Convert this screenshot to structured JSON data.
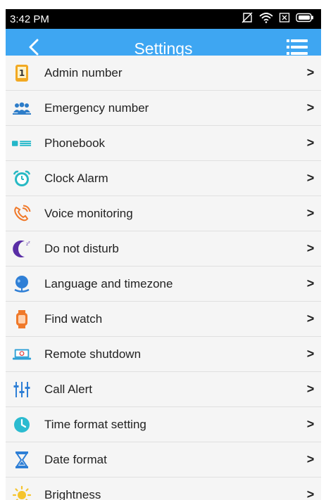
{
  "status_bar": {
    "time": "3:42 PM",
    "icons": [
      "no-sim-icon",
      "wifi-icon",
      "sim-x-icon",
      "battery-icon"
    ]
  },
  "app_bar": {
    "title": "Settings",
    "back_icon": "chevron-left-icon",
    "menu_icon": "menu-list-icon"
  },
  "settings": [
    {
      "label": "Admin number",
      "icon": "admin-number-icon",
      "chevron": ">"
    },
    {
      "label": "Emergency number",
      "icon": "emergency-contacts-icon",
      "chevron": ">"
    },
    {
      "label": "Phonebook",
      "icon": "phonebook-icon",
      "chevron": ">"
    },
    {
      "label": "Clock Alarm",
      "icon": "alarm-clock-icon",
      "chevron": ">"
    },
    {
      "label": "Voice monitoring",
      "icon": "voice-phone-icon",
      "chevron": ">"
    },
    {
      "label": "Do not disturb",
      "icon": "moon-icon",
      "chevron": ">"
    },
    {
      "label": "Language and timezone",
      "icon": "globe-icon",
      "chevron": ">"
    },
    {
      "label": "Find watch",
      "icon": "watch-icon",
      "chevron": ">"
    },
    {
      "label": "Remote shutdown",
      "icon": "laptop-power-icon",
      "chevron": ">"
    },
    {
      "label": "Call Alert",
      "icon": "sliders-icon",
      "chevron": ">"
    },
    {
      "label": "Time format setting",
      "icon": "clock-icon",
      "chevron": ">"
    },
    {
      "label": "Date format",
      "icon": "hourglass-icon",
      "chevron": ">"
    },
    {
      "label": "Brightness",
      "icon": "sun-icon",
      "chevron": ">"
    }
  ],
  "colors": {
    "app_bar": "#3ea6f2",
    "status_bar": "#000000",
    "list_bg": "#f5f5f5",
    "divider": "#e0e0e0"
  }
}
